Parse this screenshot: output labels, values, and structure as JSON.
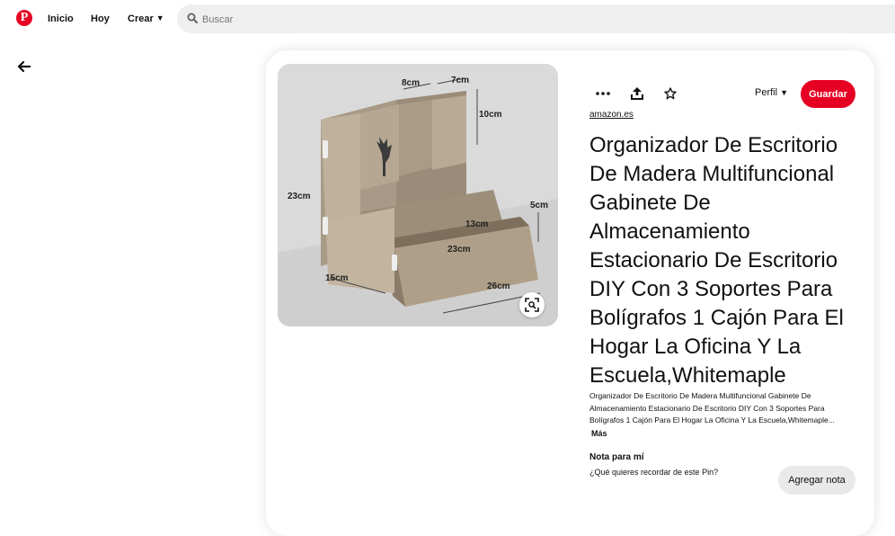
{
  "nav": {
    "logo_letter": "P",
    "inicio": "Inicio",
    "hoy": "Hoy",
    "crear": "Crear",
    "search_placeholder": "Buscar"
  },
  "brand_color": "#e60023",
  "icons": {
    "back": "arrow-left-icon",
    "more": "ellipsis-icon",
    "share": "share-upload-icon",
    "favorite": "star-outline-icon",
    "visual_search": "lens-icon",
    "search": "search-icon"
  },
  "pin": {
    "image_dimensions": [
      "8cm",
      "7cm",
      "10cm",
      "23cm",
      "5cm",
      "13cm",
      "23cm",
      "15cm",
      "26cm"
    ],
    "perfil": "Perfil",
    "guardar": "Guardar",
    "source": "amazon.es",
    "title": "Organizador De Escritorio De Madera Multifuncional Gabinete De Almacenamiento Estacionario De Escritorio DIY Con 3 Soportes Para Bolígrafos 1 Cajón Para El Hogar La Oficina Y La Escuela,Whitemaple",
    "description": "Organizador De Escritorio De Madera Multifuncional Gabinete De Almacenamiento Estacionario De Escritorio DIY Con 3 Soportes Para Bolígrafos 1 Cajón Para El Hogar La Oficina Y La Escuela,Whitemaple...",
    "more": "Más",
    "note_title": "Nota para mí",
    "note_prompt": "¿Qué quieres recordar de este Pin?",
    "add_note": "Agregar nota"
  }
}
